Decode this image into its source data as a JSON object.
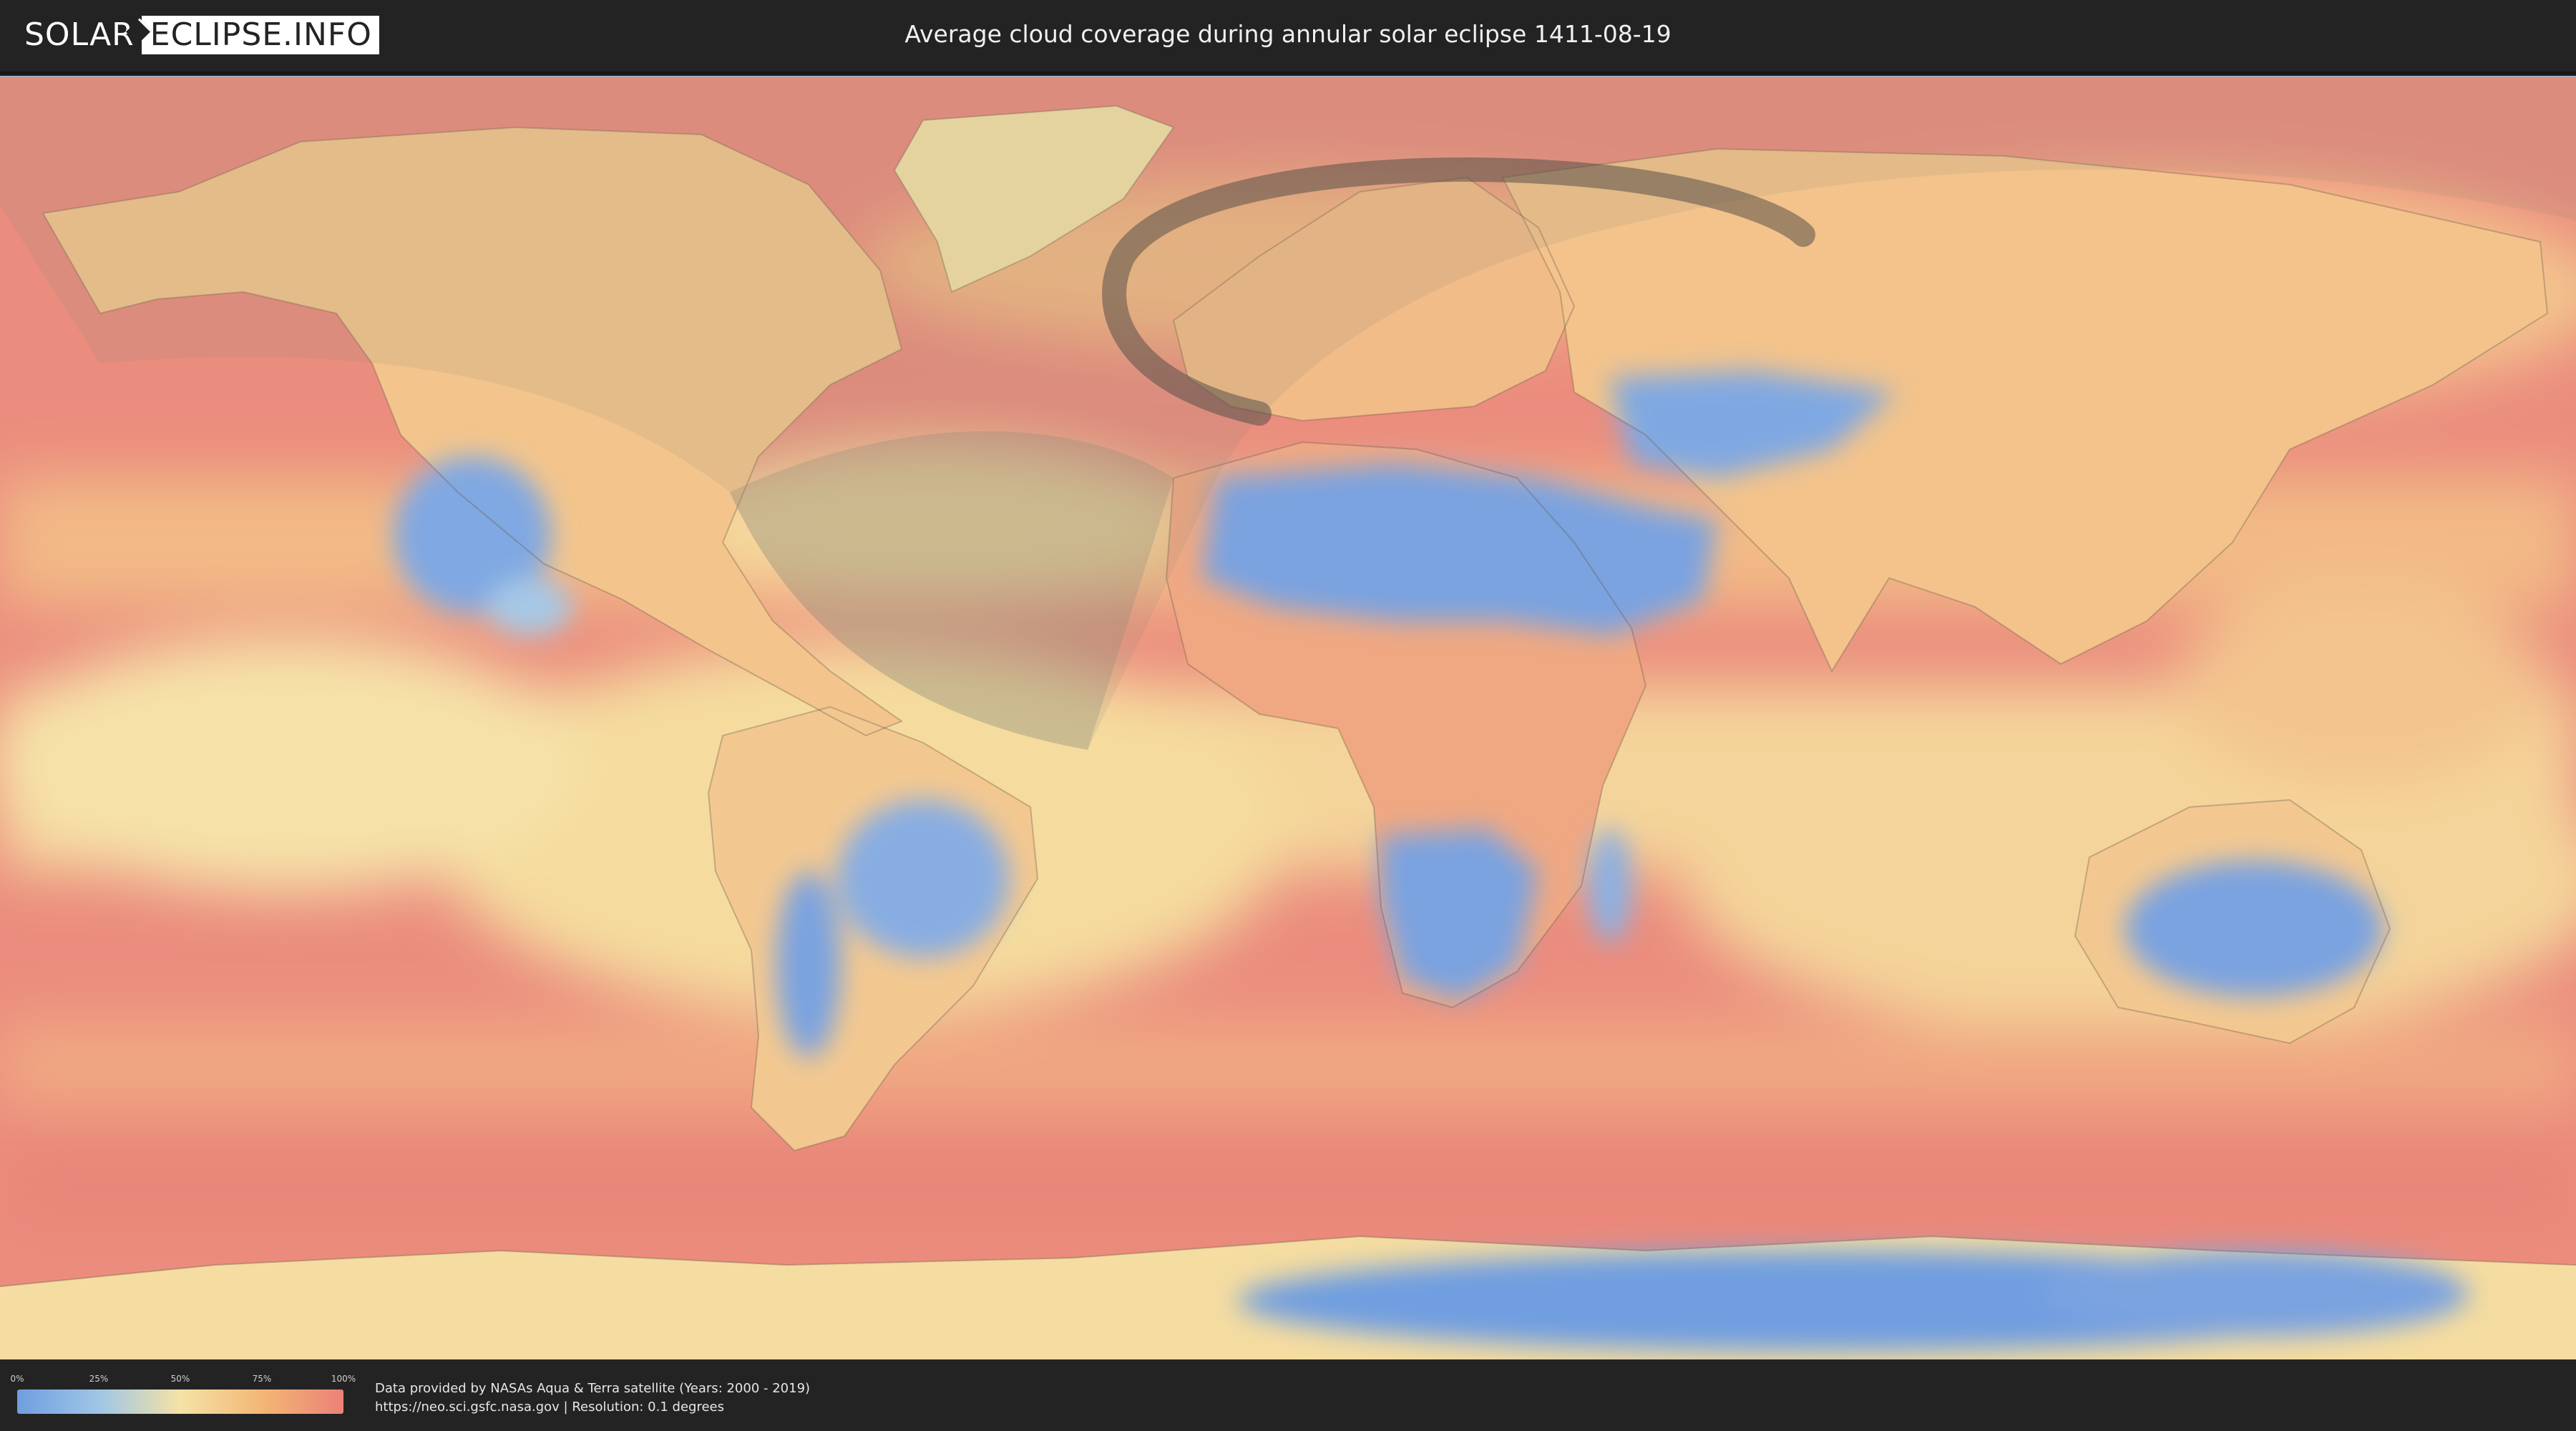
{
  "header": {
    "logo_part1": "SOLAR",
    "logo_part2": "ECLIPSE.INFO",
    "title": "Average cloud coverage during annular solar eclipse 1411-08-19"
  },
  "map": {
    "kind": "cloud-coverage world map",
    "color_scale": {
      "stops": [
        {
          "label": "0%",
          "color": "#6f9ee0"
        },
        {
          "label": "25%",
          "color": "#9fc6e6"
        },
        {
          "label": "50%",
          "color": "#f5e2a6"
        },
        {
          "label": "75%",
          "color": "#f3b776"
        },
        {
          "label": "100%",
          "color": "#ec8177"
        }
      ]
    },
    "eclipse_visibility_overlay_color": "#8a8a7a",
    "annularity_path_color": "#5a5048"
  },
  "footer": {
    "credit_line1": "Data provided by NASAs Aqua & Terra satellite (Years: 2000 - 2019)",
    "credit_line2": "https://neo.sci.gsfc.nasa.gov | Resolution: 0.1 degrees"
  }
}
